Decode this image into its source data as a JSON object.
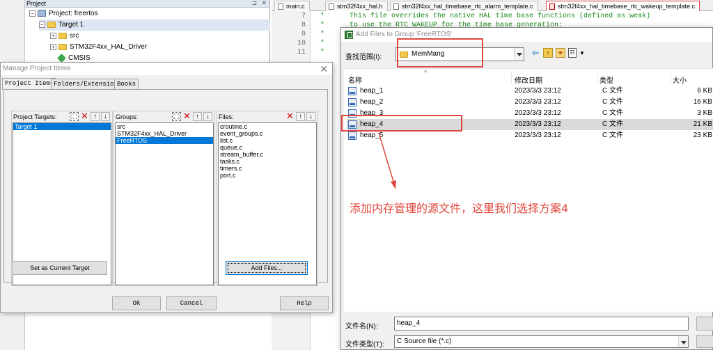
{
  "ide": {
    "project_panel": {
      "title": "Project",
      "pin": "⊐",
      "close": "✕",
      "tree": [
        {
          "label": "Project: freertos",
          "expander": "−",
          "icon": "project"
        },
        {
          "label": "Target 1",
          "expander": "−",
          "icon": "folder"
        },
        {
          "label": "src",
          "expander": "+",
          "icon": "folder"
        },
        {
          "label": "STM32F4xx_HAL_Driver",
          "expander": "+",
          "icon": "folder"
        },
        {
          "label": "CMSIS",
          "expander": "",
          "icon": "gem"
        }
      ]
    },
    "editor_tabs": [
      {
        "label": "main.c"
      },
      {
        "label": "stm32f4xx_hal.h"
      },
      {
        "label": "stm32f4xx_hal_timebase_rtc_alarm_template.c"
      },
      {
        "label": "stm32f4xx_hal_timebase_rtc_wakeup_template.c"
      }
    ],
    "line_numbers": [
      "7",
      "8",
      "9",
      "10",
      "11"
    ],
    "code_lines": [
      "*      This file overrides the native HAL time base functions (defined as weak)",
      "*      to use the RTC WAKEUP for the time base generation:",
      "*",
      "*",
      "*"
    ]
  },
  "manage_dialog": {
    "title": "Manage Project Items",
    "close": "✕",
    "tabs": [
      "Project Items",
      "Folders/Extensions",
      "Books"
    ],
    "targets": {
      "label": "Project Targets:",
      "items": [
        "Target 1"
      ],
      "selected": 0
    },
    "groups": {
      "label": "Groups:",
      "items": [
        "src",
        "STM32F4xx_HAL_Driver",
        "FreeRTOS"
      ],
      "selected": 2
    },
    "files": {
      "label": "Files:",
      "items": [
        "croutine.c",
        "event_groups.c",
        "list.c",
        "queue.c",
        "stream_buffer.c",
        "tasks.c",
        "timers.c",
        "port.c"
      ]
    },
    "tool_glyphs": {
      "new": "⬚",
      "delete": "✕",
      "up": "↑",
      "down": "↓"
    },
    "buttons": {
      "set_current_target": "Set as Current Target",
      "add_files": "Add Files...",
      "ok": "OK",
      "cancel": "Cancel",
      "help": "Help"
    }
  },
  "add_files_dialog": {
    "title": "Add Files to Group 'FreeRTOS'",
    "look_in_label": "查找范围(I):",
    "look_in_value": "MemMang",
    "nav_glyphs": {
      "back": "⇦",
      "up": "↑",
      "new_folder": "✳",
      "views": "☷",
      "views_dd": "▼"
    },
    "sort_caret": "^",
    "columns": {
      "name": "名称",
      "date": "修改日期",
      "type": "类型",
      "size": "大小"
    },
    "files": [
      {
        "name": "heap_1",
        "date": "2023/3/3 23:12",
        "type": "C 文件",
        "size": "6 KB"
      },
      {
        "name": "heap_2",
        "date": "2023/3/3 23:12",
        "type": "C 文件",
        "size": "16 KB"
      },
      {
        "name": "heap_3",
        "date": "2023/3/3 23:12",
        "type": "C 文件",
        "size": "3 KB"
      },
      {
        "name": "heap_4",
        "date": "2023/3/3 23:12",
        "type": "C 文件",
        "size": "21 KB"
      },
      {
        "name": "heap_5",
        "date": "2023/3/3 23:12",
        "type": "C 文件",
        "size": "23 KB"
      }
    ],
    "selected_index": 3,
    "filename_label": "文件名(N):",
    "filename_value": "heap_4",
    "filetype_label": "文件类型(T):",
    "filetype_value": "C Source file (*.c)"
  },
  "annotation": {
    "text": "添加内存管理的源文件，这里我们选择方案4",
    "color": "#e0473c"
  }
}
